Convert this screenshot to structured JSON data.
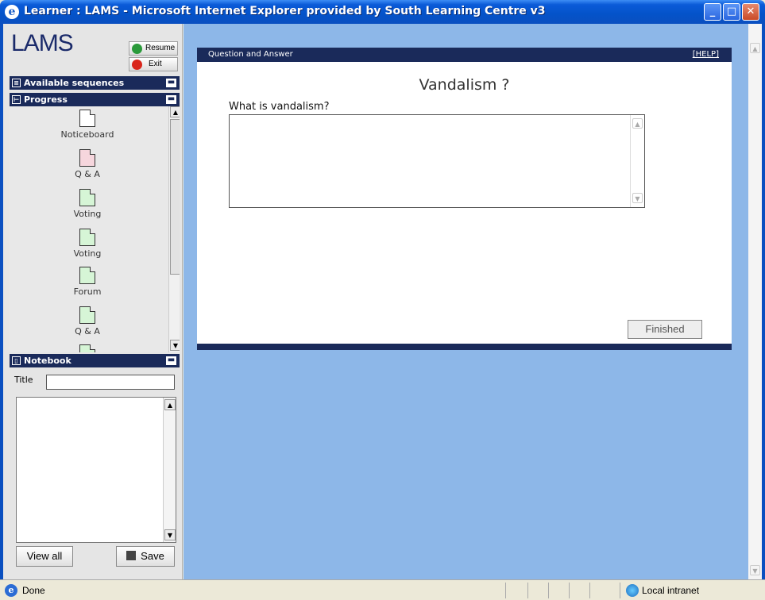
{
  "window": {
    "title": "Learner : LAMS - Microsoft Internet Explorer provided by South Learning Centre v3",
    "icon": "ie-icon",
    "controls": {
      "minimize": "minimize-icon",
      "maximize": "maximize-icon",
      "close": "close-icon"
    }
  },
  "sidebar": {
    "logo": "LAMS",
    "resume_label": "Resume",
    "exit_label": "Exit",
    "available_header": "Available sequences",
    "progress_header": "Progress",
    "notebook_header": "Notebook",
    "activities": [
      {
        "label": "Noticeboard",
        "status": "complete"
      },
      {
        "label": "Q & A",
        "status": "current"
      },
      {
        "label": "Voting",
        "status": "todo"
      },
      {
        "label": "Voting",
        "status": "todo"
      },
      {
        "label": "Forum",
        "status": "todo"
      },
      {
        "label": "Q & A",
        "status": "todo"
      }
    ],
    "notebook": {
      "title_label": "Title",
      "title_value": "",
      "text_value": "",
      "view_all_label": "View all",
      "save_label": "Save"
    }
  },
  "main": {
    "header_label": "Question and Answer",
    "help_label": "[HELP]",
    "title": "Vandalism ?",
    "question": "What is vandalism?",
    "answer_value": "",
    "finished_label": "Finished"
  },
  "statusbar": {
    "status": "Done",
    "zone": "Local intranet"
  },
  "colors": {
    "header_navy": "#1a2a5a",
    "content_bg": "#8db7e8",
    "titlebar_blue": "#0453c9"
  }
}
